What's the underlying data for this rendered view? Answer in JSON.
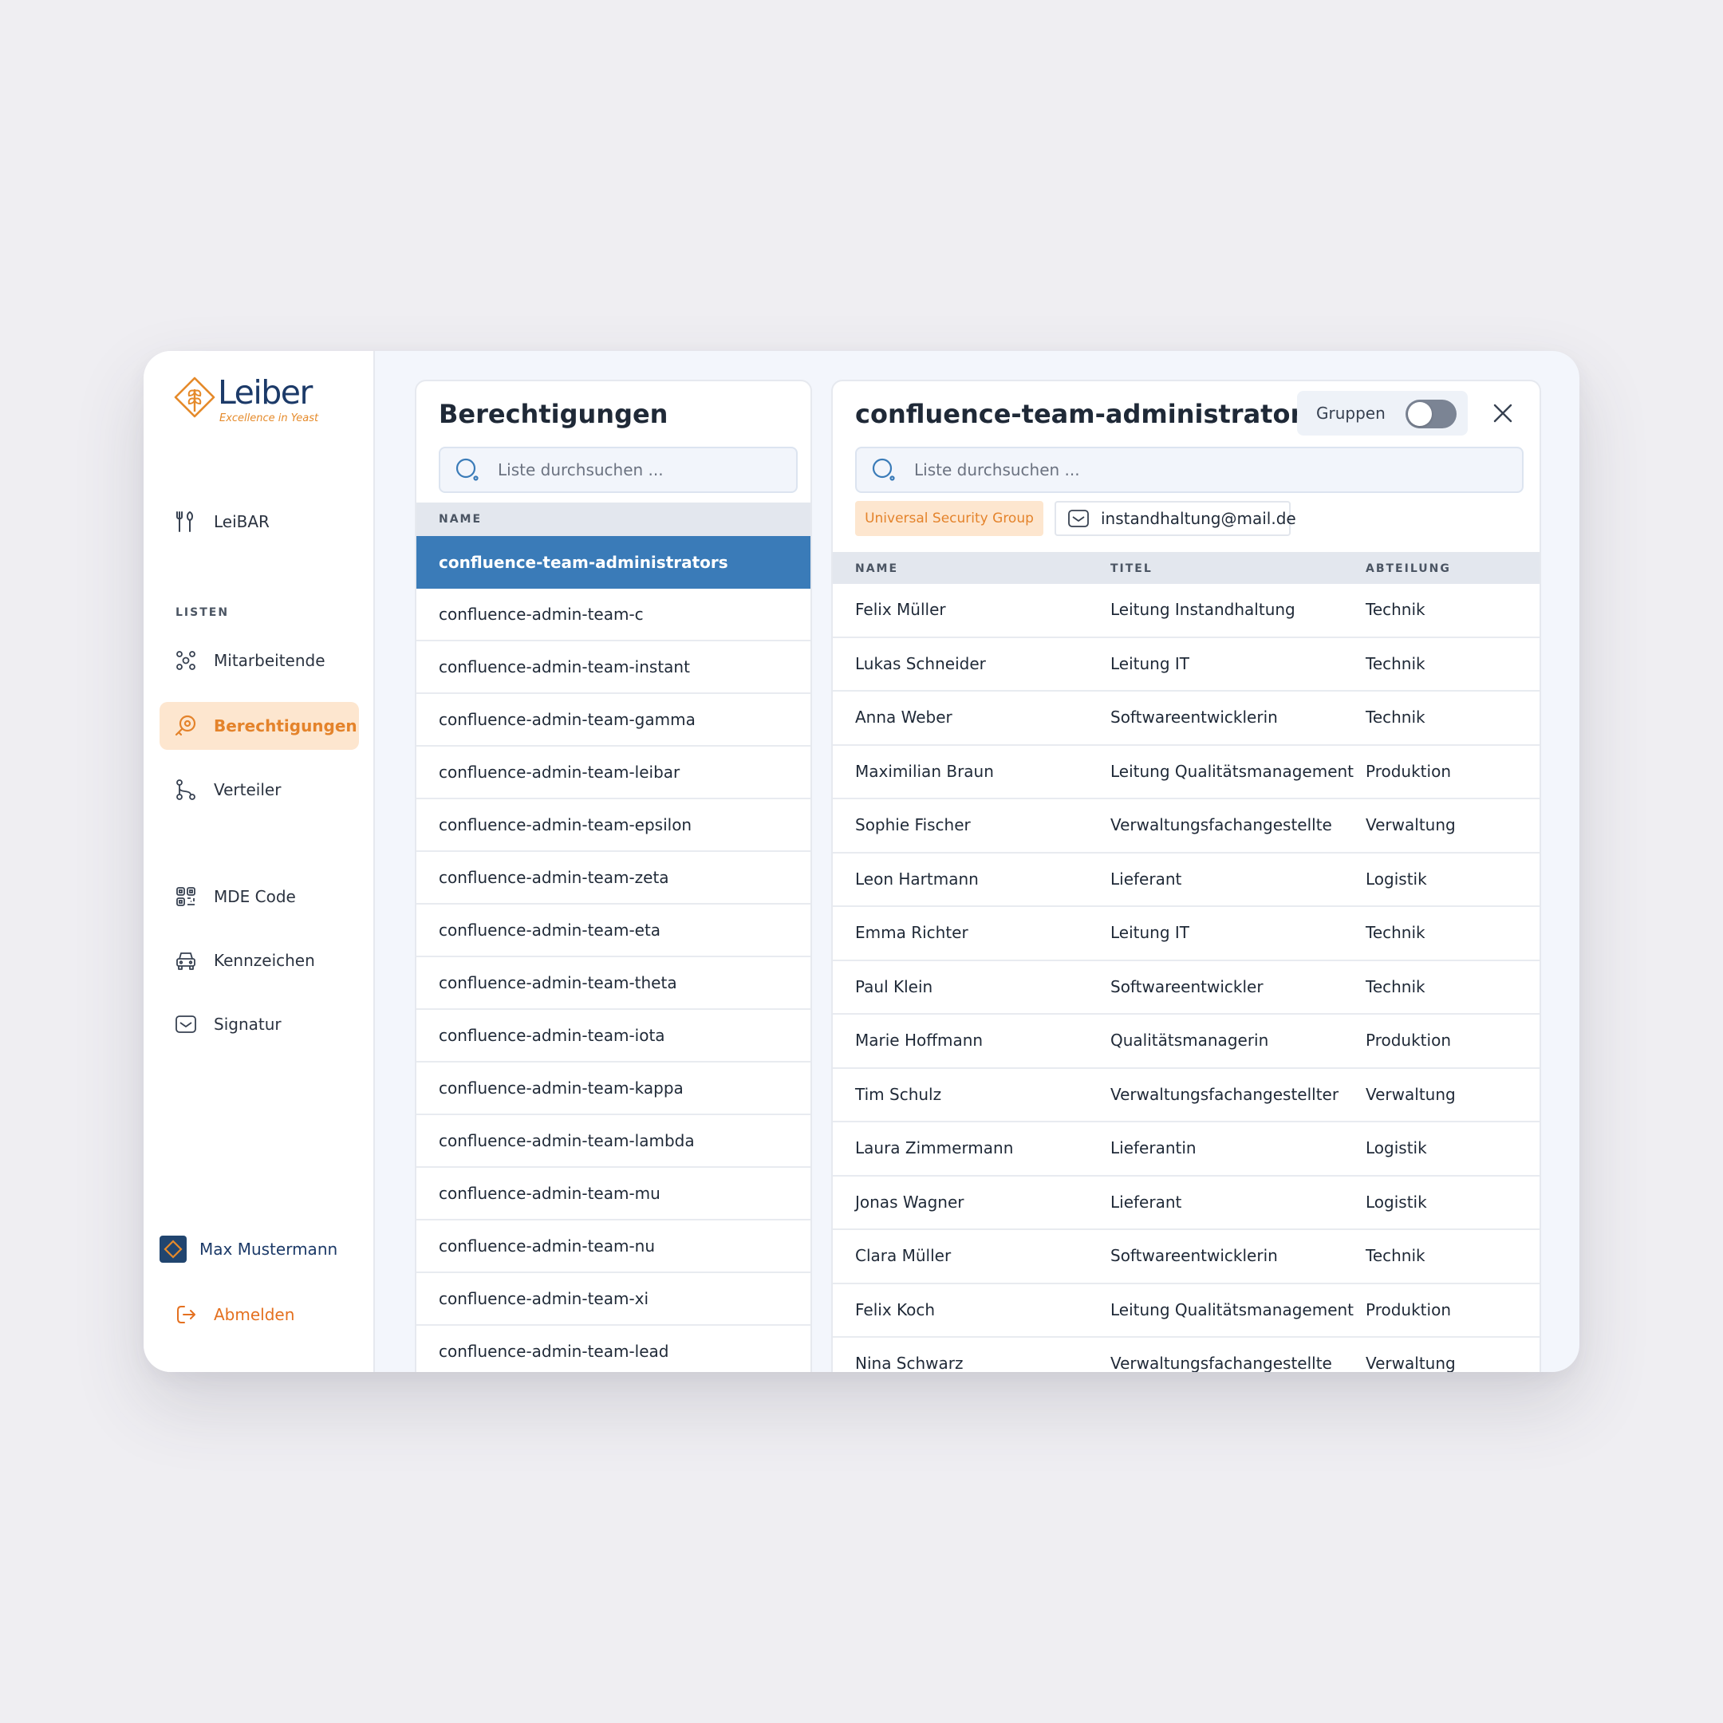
{
  "brand": {
    "name": "Leiber",
    "tagline": "Excellence in Yeast",
    "colors": {
      "primary": "#1c3a68",
      "accent": "#e4832b",
      "selected": "#3a7bb8"
    }
  },
  "sidebar": {
    "top_item": {
      "label": "LeiBAR",
      "icon": "fork-knife-icon"
    },
    "section_label": "LISTEN",
    "items": [
      {
        "label": "Mitarbeitende",
        "icon": "people-icon"
      },
      {
        "label": "Berechtigungen",
        "icon": "key-icon",
        "active": true
      },
      {
        "label": "Verteiler",
        "icon": "branch-icon"
      }
    ],
    "tools": [
      {
        "label": "MDE Code",
        "icon": "qr-code-icon"
      },
      {
        "label": "Kennzeichen",
        "icon": "car-icon"
      },
      {
        "label": "Signatur",
        "icon": "mail-icon"
      }
    ],
    "user": {
      "name": "Max Mustermann"
    },
    "logout": {
      "label": "Abmelden",
      "icon": "logout-icon"
    }
  },
  "permissions_panel": {
    "title": "Berechtigungen",
    "search_placeholder": "Liste durchsuchen ...",
    "column_header": "NAME",
    "items": [
      "confluence-team-administrators",
      "confluence-admin-team-c",
      "confluence-admin-team-instant",
      "confluence-admin-team-gamma",
      "confluence-admin-team-leibar",
      "confluence-admin-team-epsilon",
      "confluence-admin-team-zeta",
      "confluence-admin-team-eta",
      "confluence-admin-team-theta",
      "confluence-admin-team-iota",
      "confluence-admin-team-kappa",
      "confluence-admin-team-lambda",
      "confluence-admin-team-mu",
      "confluence-admin-team-nu",
      "confluence-admin-team-xi",
      "confluence-admin-team-lead"
    ],
    "selected_index": 0
  },
  "detail_panel": {
    "title": "confluence-team-administrators",
    "toggle_label": "Gruppen",
    "toggle_on": false,
    "search_placeholder": "Liste durchsuchen ...",
    "group_type": "Universal Security Group",
    "email": "instandhaltung@mail.de",
    "columns": [
      "NAME",
      "TITEL",
      "ABTEILUNG"
    ],
    "rows": [
      [
        "Felix Müller",
        "Leitung Instandhaltung",
        "Technik"
      ],
      [
        "Lukas Schneider",
        "Leitung IT",
        "Technik"
      ],
      [
        "Anna Weber",
        "Softwareentwicklerin",
        "Technik"
      ],
      [
        "Maximilian Braun",
        "Leitung Qualitätsmanagement",
        "Produktion"
      ],
      [
        "Sophie Fischer",
        "Verwaltungsfachangestellte",
        "Verwaltung"
      ],
      [
        "Leon Hartmann",
        "Lieferant",
        "Logistik"
      ],
      [
        "Emma Richter",
        "Leitung IT",
        "Technik"
      ],
      [
        "Paul Klein",
        "Softwareentwickler",
        "Technik"
      ],
      [
        "Marie Hoffmann",
        "Qualitätsmanagerin",
        "Produktion"
      ],
      [
        "Tim Schulz",
        "Verwaltungsfachangestellter",
        "Verwaltung"
      ],
      [
        "Laura Zimmermann",
        "Lieferantin",
        "Logistik"
      ],
      [
        "Jonas Wagner",
        "Lieferant",
        "Logistik"
      ],
      [
        "Clara Müller",
        "Softwareentwicklerin",
        "Technik"
      ],
      [
        "Felix Koch",
        "Leitung Qualitätsmanagement",
        "Produktion"
      ],
      [
        "Nina Schwarz",
        "Verwaltungsfachangestellte",
        "Verwaltung"
      ]
    ]
  }
}
